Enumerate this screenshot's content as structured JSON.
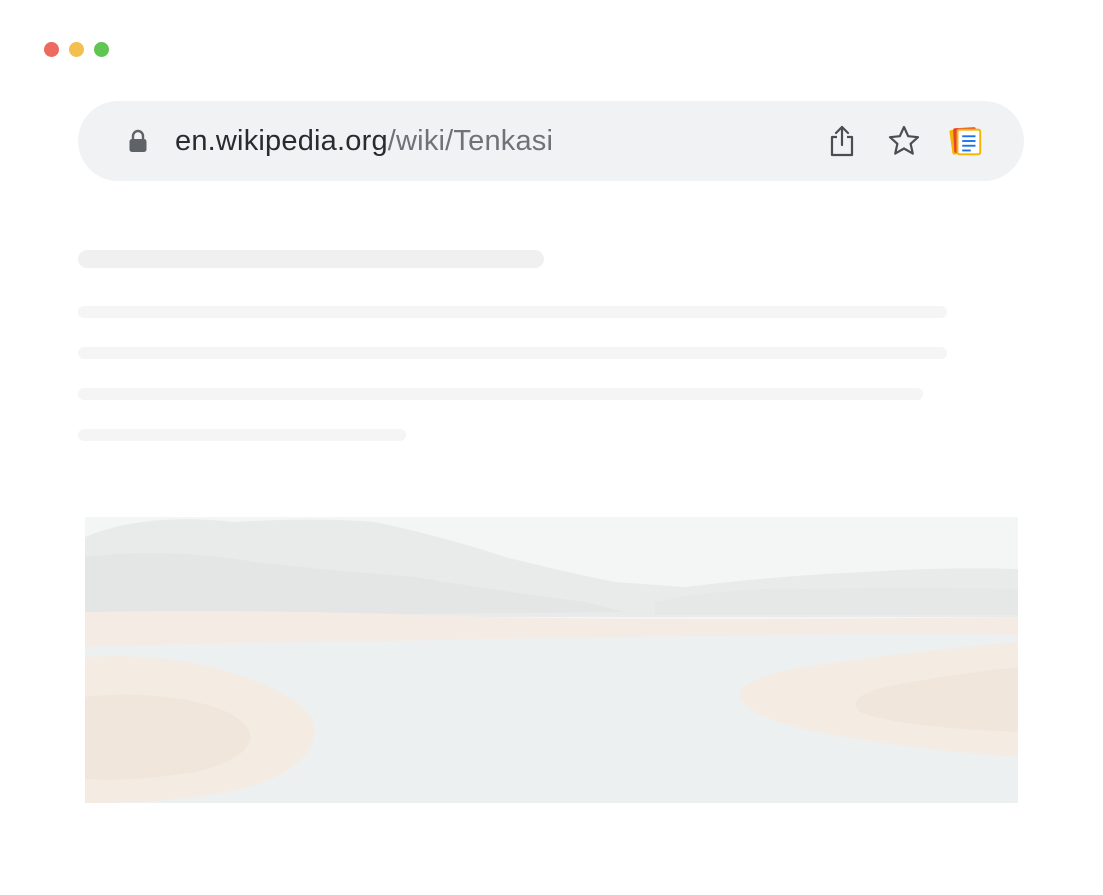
{
  "window": {
    "traffic_lights": {
      "close_color": "#ec6a5e",
      "minimize_color": "#f4bf4f",
      "zoom_color": "#61c554"
    }
  },
  "address_bar": {
    "domain": "en.wikipedia.org",
    "path": "/wiki/Tenkasi",
    "icons": {
      "lock": "lock-icon",
      "share": "share-icon",
      "bookmark": "star-icon",
      "extension": "notes-extension-icon"
    }
  },
  "content": {
    "loading_placeholder": true,
    "image": {
      "subject": "faded-landscape-placeholder"
    }
  }
}
